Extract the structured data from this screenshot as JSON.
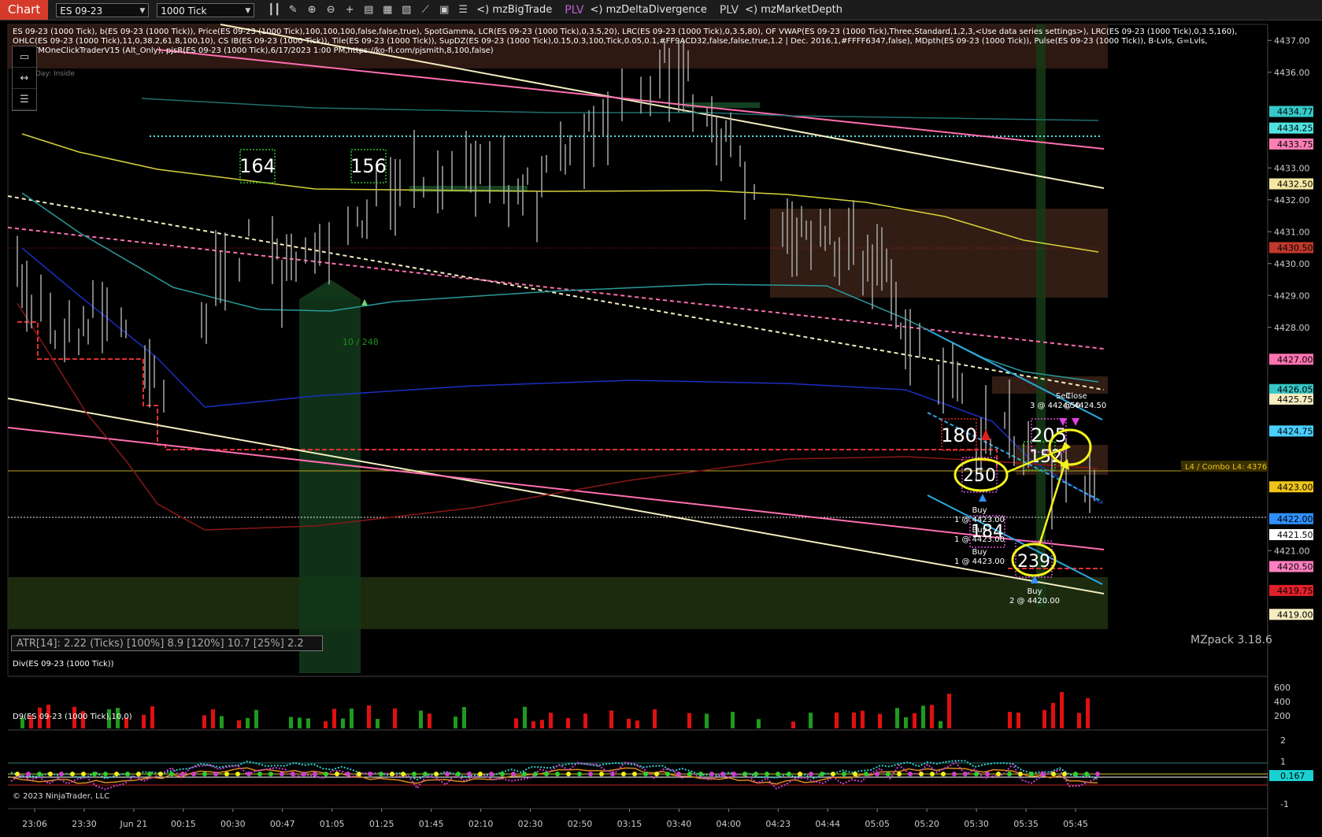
{
  "toolbar": {
    "chart_tab": "Chart",
    "instrument": "ES 09-23",
    "interval": "1000 Tick",
    "indicator_buttons": [
      "<) mzBigTrade",
      "PLV",
      "<) mzDeltaDivergence",
      "PLV",
      "<) mzMarketDepth"
    ],
    "icons": [
      "bar-style-icon",
      "draw-icon",
      "zoom-in-icon",
      "zoom-out-icon",
      "crosshair-icon",
      "data-box-icon",
      "indicators-icon",
      "strategies-icon",
      "chart-trader-icon",
      "templates-icon",
      "properties-icon"
    ]
  },
  "indicator_text": "ES 09-23 (1000 Tick), b(ES 09-23 (1000 Tick)), Price(ES 09-23 (1000 Tick),100,100,100,false,false,true), SpotGamma, LCR(ES 09-23 (1000 Tick),0,3.5,20), LRC(ES 09-23 (1000 Tick),0,3.5,80), OF VWAP(ES 09-23 (1000 Tick),Three,Standard,1,2,3,<Use data series settings>), LRC(ES 09-23 (1000 Tick),0,3.5,160), OHLC(ES 09-23 (1000 Tick),11,0,38.2,61.8,100,10), CS IB(ES 09-23 (1000 Tick)), Tile(ES 09-23 (1000 Tick)), SupDZ(ES 09-23 (1000 Tick),0.15,0.3,100,Tick,0.05,0.1,#FF9ACD32,false,false,true,1.2 | Dec. 2016,1,#FFFF6347,false), MDpth(ES 09-23 (1000 Tick)), Pulse(ES 09-23 (1000 Tick)), B-Lvls, G=Lvls, wdcATMOneClickTraderV15 (Alt_Only), pjsR(ES 09-23 (1000 Tick),6/17/2023 1:00 PM,https://ko-fi.com/pjsmith,8,100,false)",
  "day_label": "Day: Inside",
  "atr_text": "ATR[14]: 2.22 (Ticks) [100%] 8.9  [120%] 10.7  [25%] 2.2",
  "mzpack_version": "MZpack 3.18.6",
  "copyright": "© 2023 NinjaTrader, LLC",
  "div_panel_title": "Div(ES 09-23 (1000 Tick))",
  "d9_panel_title": "D9(ES 09-23 (1000 Tick),10,0)",
  "combo_label": "L4 / Combo L4: 4376",
  "delta_marker": "10 / 248",
  "price_axis": {
    "ticks": [
      "4437.00",
      "4436.00",
      "4433.00",
      "4432.00",
      "4431.00",
      "4430.00",
      "4429.00",
      "4428.00",
      "4421.00"
    ],
    "badges": [
      {
        "value": "4434.77",
        "color": "#36c9c9"
      },
      {
        "value": "4434.25",
        "color": "#4fe3e3"
      },
      {
        "value": "4433.75",
        "color": "#ff7fb4"
      },
      {
        "value": "4432.50",
        "color": "#f5e7a1"
      },
      {
        "value": "4430.50",
        "color": "#c0392b"
      },
      {
        "value": "4427.00",
        "color": "#ff73b0"
      },
      {
        "value": "4426.05",
        "color": "#38c6c6"
      },
      {
        "value": "4425.75",
        "color": "#f5ecc0"
      },
      {
        "value": "4424.75",
        "color": "#4ad0ff"
      },
      {
        "value": "4423.00",
        "color": "#f0c419"
      },
      {
        "value": "4422.00",
        "color": "#2f8fff"
      },
      {
        "value": "4421.50",
        "color": "#ffffff"
      },
      {
        "value": "4420.50",
        "color": "#ff7fc0"
      },
      {
        "value": "4419.75",
        "color": "#e0202a"
      },
      {
        "value": "4419.00",
        "color": "#f5ecc0"
      }
    ]
  },
  "div_axis": [
    "600",
    "400",
    "200"
  ],
  "d9_axis": [
    "2",
    "1",
    "-1"
  ],
  "d9_value": "0.167",
  "time_axis": [
    "23:06",
    "23:30",
    "Jun 21",
    "00:15",
    "00:30",
    "00:47",
    "01:05",
    "01:25",
    "01:45",
    "02:10",
    "02:30",
    "02:50",
    "03:15",
    "03:40",
    "04:00",
    "04:23",
    "04:44",
    "05:05",
    "05:20",
    "05:30",
    "05:35",
    "05:45"
  ],
  "bigtrades": [
    {
      "label": "164",
      "color": "#2fbf2f"
    },
    {
      "label": "156",
      "color": "#2fbf2f"
    },
    {
      "label": "180",
      "color": "#e02020"
    },
    {
      "label": "205",
      "color": "#d24cd2"
    },
    {
      "label": "152",
      "color": "#2fbf2f"
    },
    {
      "label": "250",
      "color": "#d24cd2"
    },
    {
      "label": "184",
      "color": "#d24cd2"
    },
    {
      "label": "239",
      "color": "#d24cd2"
    }
  ],
  "trade_labels": [
    {
      "side": "Buy",
      "detail": "1 @ 4423.00"
    },
    {
      "side": "Buy",
      "detail": "1 @ 4423.00"
    },
    {
      "side": "Buy",
      "detail": "1 @ 4423.00"
    },
    {
      "side": "Buy",
      "detail": "2 @ 4420.00"
    },
    {
      "side": "Sell",
      "detail": "3 @ 4424.50"
    },
    {
      "side": "Close",
      "detail": "@ 4424.50"
    }
  ],
  "colors": {
    "background": "#000000",
    "up_bar": "#c8c8c8",
    "div_red": "#e01010",
    "div_green": "#1e9a1e",
    "vwap_yellow": "#d8d23a",
    "lrc_teal": "#2a9a9a",
    "lrc_blue": "#1b2fbf",
    "line_pink": "#ff6fb0",
    "line_cream": "#f3eec0",
    "channel_cyan": "#2aa8e0",
    "annotation_yellow": "#f3f31c"
  }
}
